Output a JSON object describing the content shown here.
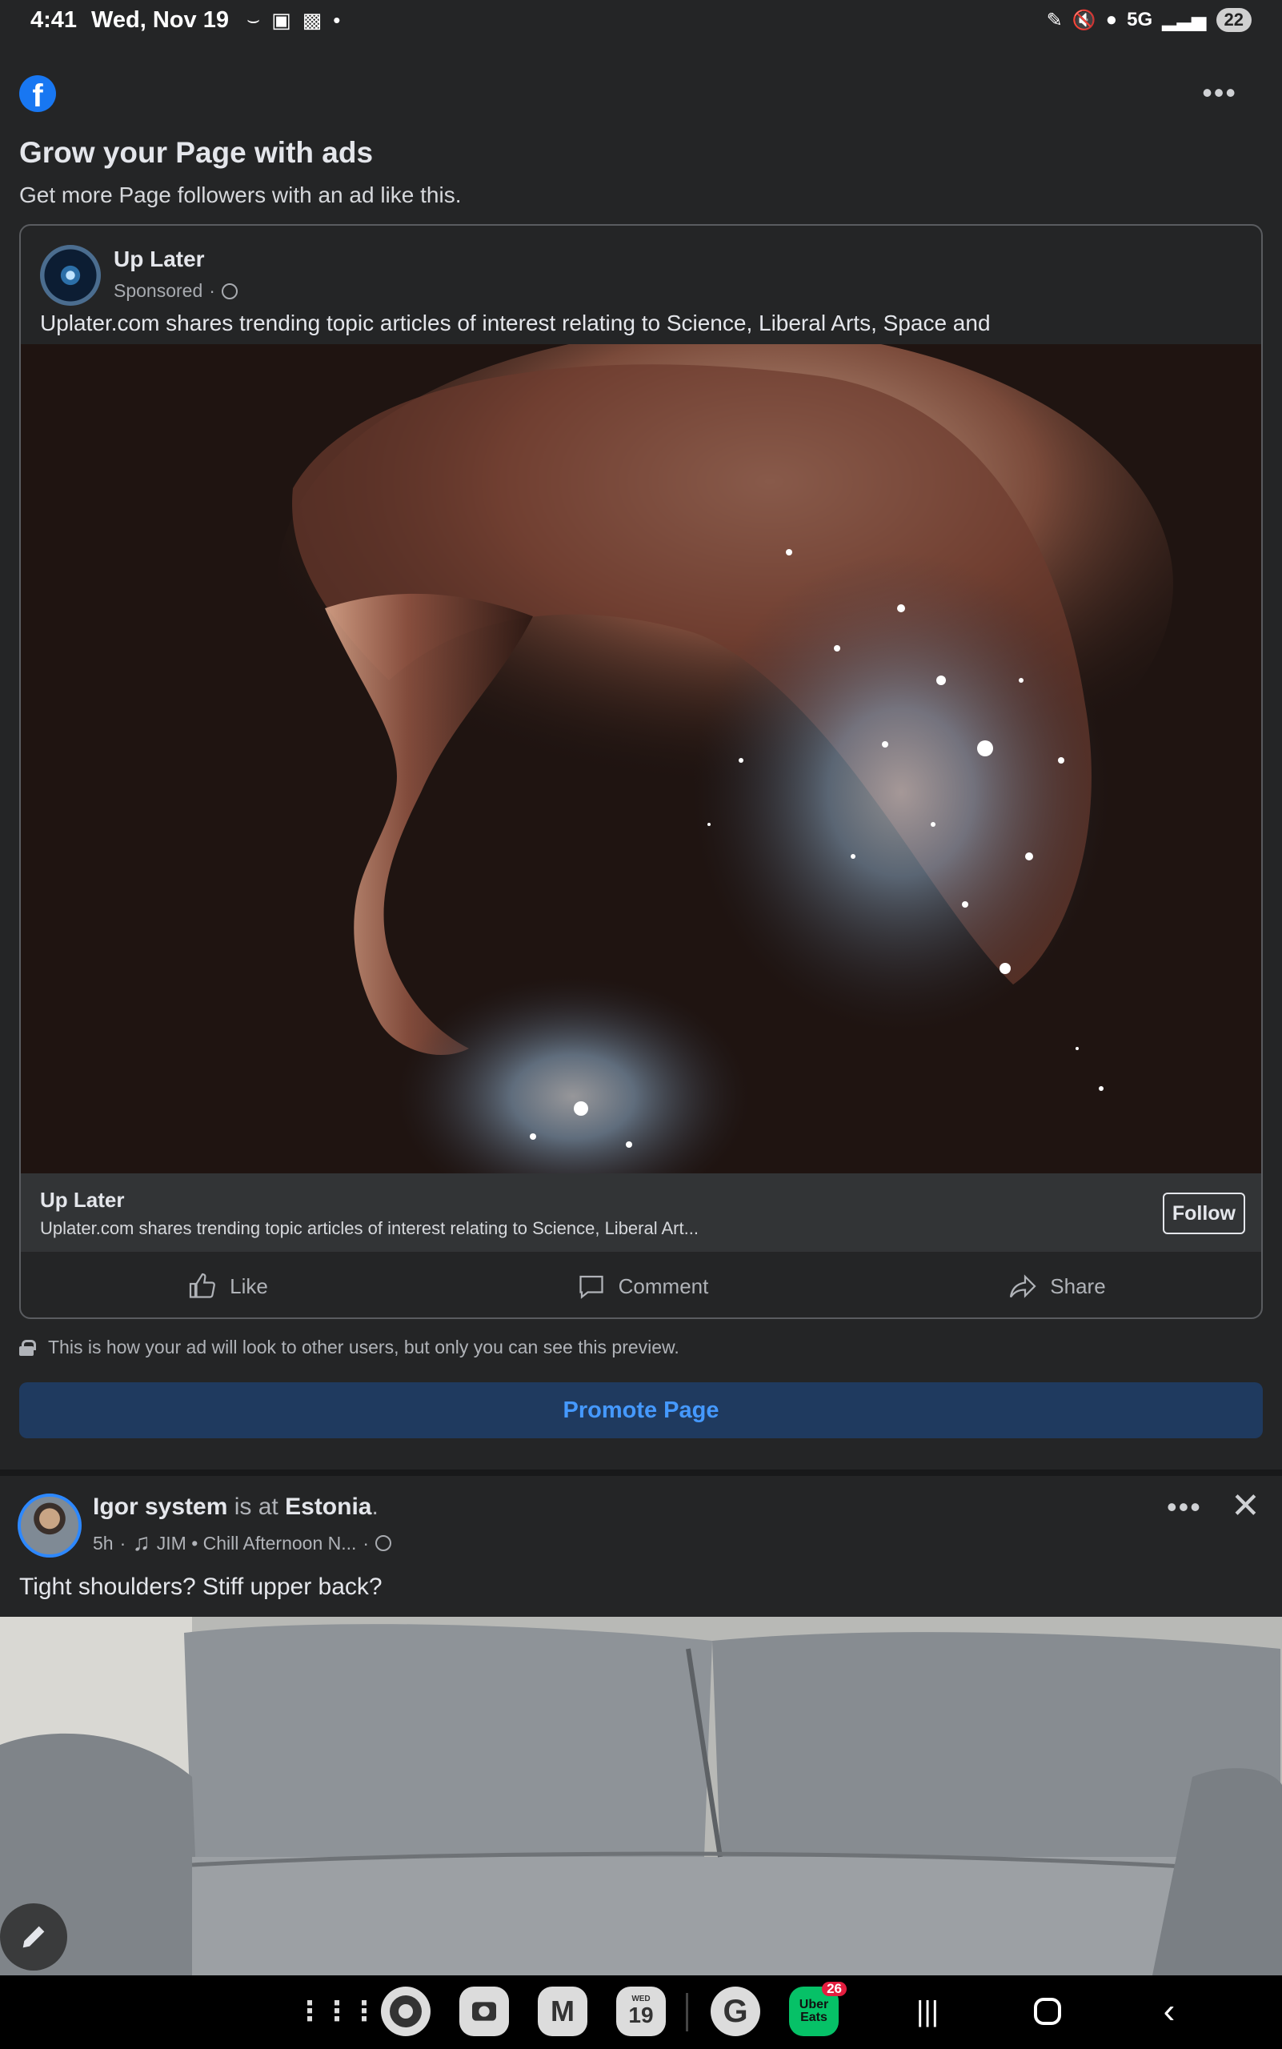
{
  "status_bar": {
    "time": "4:41",
    "date": "Wed, Nov 19",
    "network": "5G",
    "battery": "22"
  },
  "header": {
    "logo_icon": "facebook-logo-icon",
    "more_icon": "more-horizontal-icon"
  },
  "promo": {
    "title": "Grow your Page with ads",
    "subtitle": "Get more Page followers with an ad like this."
  },
  "ad": {
    "page_name": "Up Later",
    "sponsored": "Sponsored",
    "text": "Uplater.com shares trending topic articles of interest relating to Science, Liberal Arts, Space and",
    "footer_name": "Up Later",
    "footer_desc": "Uplater.com shares trending topic articles of interest relating to Science, Liberal Art...",
    "follow_label": "Follow",
    "actions": {
      "like": "Like",
      "comment": "Comment",
      "share": "Share"
    }
  },
  "preview_note": "This is how your ad will look to other users, but only you can see this preview.",
  "promote_button": "Promote Page",
  "post": {
    "author": "Igor system",
    "is_at": "is at",
    "location": "Estonia",
    "time": "5h",
    "music": "JIM • Chill Afternoon N...",
    "text": "Tight shoulders? Stiff upper back?"
  },
  "navbar": {
    "calendar_day": "19",
    "calendar_weekday": "WED",
    "ubereats_label": "Uber Eats",
    "ubereats_badge": "26"
  },
  "colors": {
    "background": "#242526",
    "accent": "#1877f2",
    "promote_bg": "#1f3a5f",
    "promote_text": "#4599ff"
  }
}
